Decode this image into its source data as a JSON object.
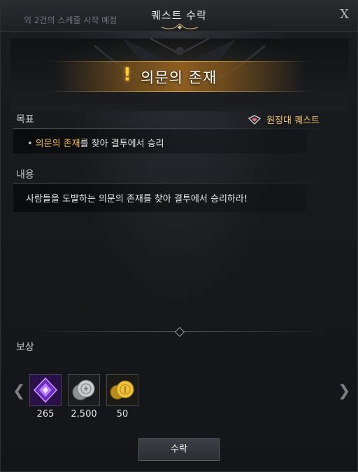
{
  "titlebar": {
    "schedule_note": "외 2건의 스케줄 시작 예정",
    "title": "퀘스트 수락",
    "close_label": "X"
  },
  "quest": {
    "name": "의문의 존재",
    "type_label": "원정대 퀘스트"
  },
  "goal": {
    "label": "목표",
    "highlight": "의문의 존재",
    "rest": "를 찾아 결투에서 승리"
  },
  "content": {
    "label": "내용",
    "text": "사람들을 도발하는 의문의 존재를 찾아 결투에서 승리하라!"
  },
  "rewards": {
    "label": "보상",
    "items": [
      {
        "icon": "purple-crystal-icon",
        "count": "265"
      },
      {
        "icon": "silver-coins-icon",
        "count": "2,500"
      },
      {
        "icon": "gold-coins-icon",
        "count": "50"
      }
    ]
  },
  "accept_label": "수락",
  "colors": {
    "accent_gold": "#f0b84c",
    "banner_gold": "#a0681e",
    "quest_mark": "#ffcc33"
  }
}
